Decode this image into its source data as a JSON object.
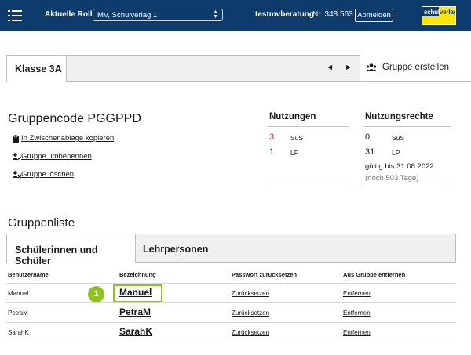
{
  "header": {
    "role_label": "Aktuelle Rolle",
    "role_select_value": "MV, Schulverlag 1",
    "username": "testmvberatung",
    "user_number": "Nr. 348 563",
    "logout_label": "Abmelden",
    "logo_text_a": "schul",
    "logo_text_b": "verlag"
  },
  "class_bar": {
    "active_class": "Klasse 3A",
    "prev_arrow": "◀",
    "next_arrow": "▶",
    "create_group_label": "Gruppe erstellen"
  },
  "group": {
    "code_title": "Gruppencode PGGPPD",
    "actions": [
      {
        "label": "In Zwischenablage kopieren",
        "icon": "clipboard-icon"
      },
      {
        "label": "Gruppe umbenennen",
        "icon": "users-edit-icon"
      },
      {
        "label": "Gruppe löschen",
        "icon": "users-delete-icon"
      }
    ]
  },
  "usage": {
    "title": "Nutzungen",
    "rows": [
      {
        "value": "3",
        "unit": "SuS",
        "color": "#d9261c"
      },
      {
        "value": "1",
        "unit": "LP",
        "color": "#1a1a1a"
      }
    ]
  },
  "rights": {
    "title": "Nutzungsrechte",
    "rows": [
      {
        "value": "0",
        "unit": "SuS"
      },
      {
        "value": "31",
        "unit": "LP"
      }
    ],
    "valid_until": "gültig bis 31.08.2022",
    "remaining": "(noch 503 Tage)"
  },
  "group_list": {
    "title": "Gruppenliste",
    "tabs": [
      "Schülerinnen und Schüler",
      "Lehrpersonen"
    ],
    "columns": [
      "Benutzername",
      "Bezeichnung",
      "Passwort zurücksetzen",
      "Aus Gruppe entfernen"
    ],
    "rows": [
      {
        "username": "Manuel",
        "label": "Manuel",
        "reset": "Zurücksetzen",
        "remove": "Entfernen"
      },
      {
        "username": "PetraM",
        "label": "PetraM",
        "reset": "Zurücksetzen",
        "remove": "Entfernen"
      },
      {
        "username": "SarahK",
        "label": "SarahK",
        "reset": "Zurücksetzen",
        "remove": "Entfernen"
      }
    ]
  },
  "annotation": {
    "badge": "1"
  },
  "colors": {
    "header_bg": "#0c3b6c",
    "accent_green": "#8fc21e",
    "usage_alert": "#d9261c",
    "logo_yellow": "#ffe600"
  }
}
